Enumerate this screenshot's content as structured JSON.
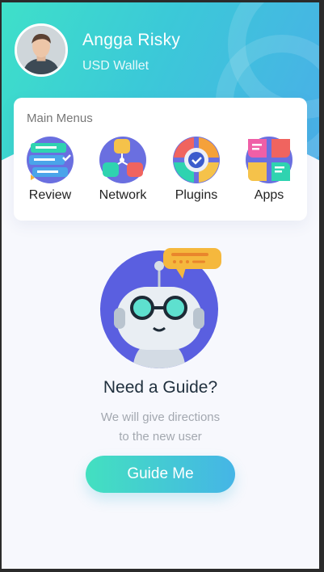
{
  "profile": {
    "name": "Angga Risky",
    "wallet": "USD Wallet"
  },
  "main_menus": {
    "title": "Main Menus",
    "items": [
      {
        "label": "Review",
        "icon": "review-icon"
      },
      {
        "label": "Network",
        "icon": "network-icon"
      },
      {
        "label": "Plugins",
        "icon": "plugins-icon"
      },
      {
        "label": "Apps",
        "icon": "apps-icon"
      }
    ]
  },
  "guide": {
    "title": "Need a Guide?",
    "line1": "We will give directions",
    "line2": "to the new user",
    "button": "Guide Me"
  },
  "colors": {
    "accent_start": "#3ee0c9",
    "accent_end": "#4aaee8"
  }
}
